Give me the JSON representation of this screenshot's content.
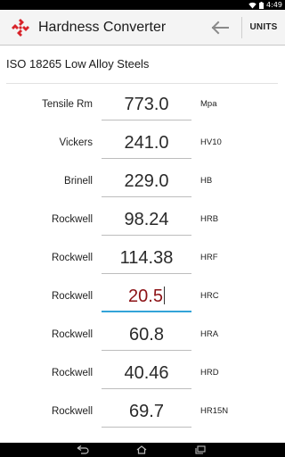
{
  "status_bar": {
    "time": "4:49",
    "icons": [
      "wifi-icon",
      "battery-icon"
    ]
  },
  "action_bar": {
    "title": "Hardness Converter",
    "logo_icon": "app-logo-icon",
    "back_icon": "arrow-left-icon",
    "units_label": "UNITS"
  },
  "standard": {
    "title": "ISO 18265 Low Alloy Steels"
  },
  "rows": [
    {
      "label": "Tensile Rm",
      "value": "773.0",
      "unit": "Mpa"
    },
    {
      "label": "Vickers",
      "value": "241.0",
      "unit": "HV10"
    },
    {
      "label": "Brinell",
      "value": "229.0",
      "unit": "HB"
    },
    {
      "label": "Rockwell",
      "value": "98.24",
      "unit": "HRB"
    },
    {
      "label": "Rockwell",
      "value": "114.38",
      "unit": "HRF"
    },
    {
      "label": "Rockwell",
      "value": "20.5",
      "unit": "HRC",
      "active": true
    },
    {
      "label": "Rockwell",
      "value": "60.8",
      "unit": "HRA"
    },
    {
      "label": "Rockwell",
      "value": "40.46",
      "unit": "HRD"
    },
    {
      "label": "Rockwell",
      "value": "69.7",
      "unit": "HR15N"
    }
  ],
  "nav_bar": {
    "icons": [
      "back-nav-icon",
      "home-nav-icon",
      "recents-nav-icon"
    ]
  },
  "colors": {
    "active_value": "#8c1216",
    "focus_underline": "#33a3d8",
    "logo_red": "#d8232a",
    "action_bar_bg": "#f4f4f4"
  }
}
